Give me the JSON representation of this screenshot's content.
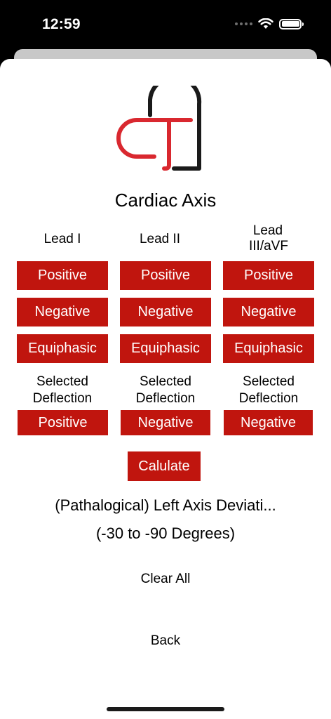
{
  "status_bar": {
    "time": "12:59"
  },
  "app": {
    "title": "Cardiac Axis"
  },
  "columns": [
    {
      "label": "Lead I",
      "buttons": [
        "Positive",
        "Negative",
        "Equiphasic"
      ],
      "selected_label": "Selected Deflection",
      "selected_value": "Positive"
    },
    {
      "label": "Lead II",
      "buttons": [
        "Positive",
        "Negative",
        "Equiphasic"
      ],
      "selected_label": "Selected Deflection",
      "selected_value": "Negative"
    },
    {
      "label": "Lead III/aVF",
      "buttons": [
        "Positive",
        "Negative",
        "Equiphasic"
      ],
      "selected_label": "Selected Deflection",
      "selected_value": "Negative"
    }
  ],
  "calculate_label": "Calulate",
  "result": {
    "line1": "(Pathalogical) Left Axis Deviati...",
    "line2": "(-30 to -90 Degrees)"
  },
  "clear_all_label": "Clear All",
  "back_label": "Back",
  "colors": {
    "accent": "#c0150e",
    "logo_red": "#d9282f",
    "logo_black": "#1a1a1a"
  }
}
